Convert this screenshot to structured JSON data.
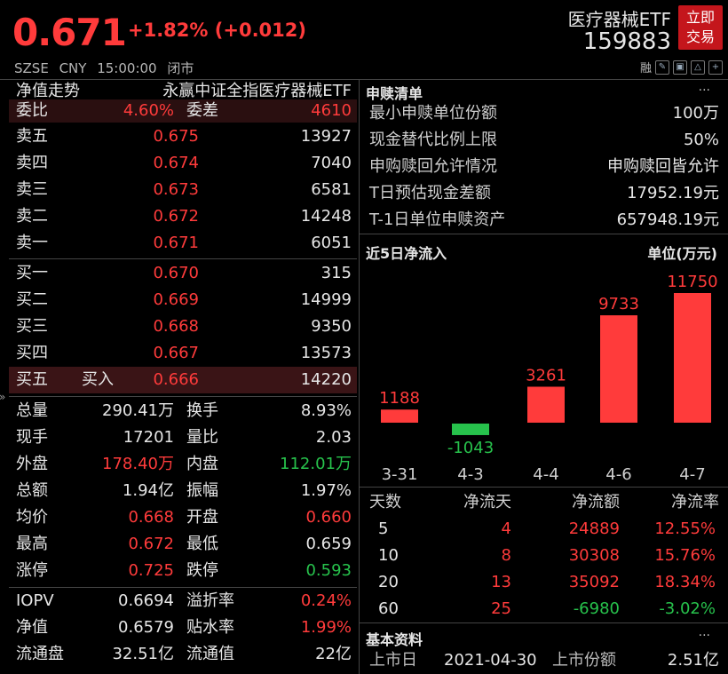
{
  "header": {
    "price": "0.671",
    "change": "+1.82% (+0.012)",
    "market": "SZSE",
    "currency": "CNY",
    "time": "15:00:00",
    "status": "闭市",
    "etf_name": "医疗器械ETF",
    "etf_code": "159883",
    "trade_button_line1": "立即",
    "trade_button_line2": "交易",
    "toolbar_text": "融"
  },
  "left": {
    "nav_label": "净值走势",
    "fund_name": "永赢中证全指医疗器械ETF",
    "ratio_label": "委比",
    "ratio_value": "4.60%",
    "diff_label": "委差",
    "diff_value": "4610",
    "asks": [
      {
        "label": "卖五",
        "price": "0.675",
        "vol": "13927"
      },
      {
        "label": "卖四",
        "price": "0.674",
        "vol": "7040"
      },
      {
        "label": "卖三",
        "price": "0.673",
        "vol": "6581"
      },
      {
        "label": "卖二",
        "price": "0.672",
        "vol": "14248"
      },
      {
        "label": "卖一",
        "price": "0.671",
        "vol": "6051"
      }
    ],
    "bids": [
      {
        "label": "买一",
        "tag": "",
        "price": "0.670",
        "vol": "315"
      },
      {
        "label": "买二",
        "tag": "",
        "price": "0.669",
        "vol": "14999"
      },
      {
        "label": "买三",
        "tag": "",
        "price": "0.668",
        "vol": "9350"
      },
      {
        "label": "买四",
        "tag": "",
        "price": "0.667",
        "vol": "13573"
      },
      {
        "label": "买五",
        "tag": "买入",
        "price": "0.666",
        "vol": "14220"
      }
    ],
    "stats": [
      {
        "k1": "总量",
        "v1": "290.41万",
        "c1": "white",
        "k2": "换手",
        "v2": "8.93%",
        "c2": "white"
      },
      {
        "k1": "现手",
        "v1": "17201",
        "c1": "white",
        "k2": "量比",
        "v2": "2.03",
        "c2": "white"
      },
      {
        "k1": "外盘",
        "v1": "178.40万",
        "c1": "red",
        "k2": "内盘",
        "v2": "112.01万",
        "c2": "green"
      },
      {
        "k1": "总额",
        "v1": "1.94亿",
        "c1": "white",
        "k2": "振幅",
        "v2": "1.97%",
        "c2": "white"
      },
      {
        "k1": "均价",
        "v1": "0.668",
        "c1": "red",
        "k2": "开盘",
        "v2": "0.660",
        "c2": "red"
      },
      {
        "k1": "最高",
        "v1": "0.672",
        "c1": "red",
        "k2": "最低",
        "v2": "0.659",
        "c2": "white"
      },
      {
        "k1": "涨停",
        "v1": "0.725",
        "c1": "red",
        "k2": "跌停",
        "v2": "0.593",
        "c2": "green"
      }
    ],
    "iopv": [
      {
        "k1": "IOPV",
        "v1": "0.6694",
        "c1": "white",
        "k2": "溢折率",
        "v2": "0.24%",
        "c2": "red"
      },
      {
        "k1": "净值",
        "v1": "0.6579",
        "c1": "white",
        "k2": "贴水率",
        "v2": "1.99%",
        "c2": "red"
      },
      {
        "k1": "流通盘",
        "v1": "32.51亿",
        "c1": "white",
        "k2": "流通值",
        "v2": "22亿",
        "c2": "white"
      }
    ]
  },
  "right": {
    "subscribe_title": "申赎清单",
    "more": "···",
    "subscribe_rows": [
      {
        "k": "最小申赎单位份额",
        "v": "100万"
      },
      {
        "k": "现金替代比例上限",
        "v": "50%"
      },
      {
        "k": "申购赎回允许情况",
        "v": "申购赎回皆允许"
      },
      {
        "k": "T日预估现金差额",
        "v": "17952.19元"
      },
      {
        "k": "T-1日单位申赎资产",
        "v": "657948.19元"
      }
    ],
    "flow_title": "近5日净流入",
    "flow_unit": "单位(万元)",
    "flow_headers": [
      "天数",
      "净流天",
      "净流额",
      "净流率"
    ],
    "flow_rows": [
      {
        "days": "5",
        "net_days": "4",
        "amount": "24889",
        "rate": "12.55%",
        "amount_color": "red",
        "rate_color": "red"
      },
      {
        "days": "10",
        "net_days": "8",
        "amount": "30308",
        "rate": "15.76%",
        "amount_color": "red",
        "rate_color": "red"
      },
      {
        "days": "20",
        "net_days": "13",
        "amount": "35092",
        "rate": "18.34%",
        "amount_color": "red",
        "rate_color": "red"
      },
      {
        "days": "60",
        "net_days": "25",
        "amount": "-6980",
        "rate": "-3.02%",
        "amount_color": "green",
        "rate_color": "green"
      }
    ],
    "basic_title": "基本资料",
    "listing_date_label": "上市日",
    "listing_date": "2021-04-30",
    "listing_shares_label": "上市份额",
    "listing_shares": "2.51亿"
  },
  "chart_data": {
    "type": "bar",
    "categories": [
      "3-31",
      "4-3",
      "4-4",
      "4-6",
      "4-7"
    ],
    "values": [
      1188,
      -1043,
      3261,
      9733,
      11750
    ],
    "title": "近5日净流入",
    "ylabel": "单位(万元)",
    "positive_color": "#ff3b3b",
    "negative_color": "#27c24c"
  }
}
